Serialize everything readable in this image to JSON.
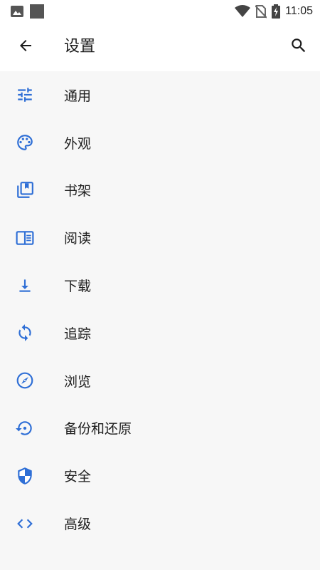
{
  "status_bar": {
    "time": "11:05",
    "icons": [
      "image-icon",
      "square-icon",
      "wifi-icon",
      "no-sim-icon",
      "battery-charging-icon"
    ]
  },
  "app_bar": {
    "title": "设置",
    "back_icon": "arrow-back-icon",
    "search_icon": "search-icon"
  },
  "settings": {
    "items": [
      {
        "label": "通用",
        "icon": "tune-icon"
      },
      {
        "label": "外观",
        "icon": "palette-icon"
      },
      {
        "label": "书架",
        "icon": "library-icon"
      },
      {
        "label": "阅读",
        "icon": "chrome-reader-icon"
      },
      {
        "label": "下载",
        "icon": "download-icon"
      },
      {
        "label": "追踪",
        "icon": "sync-icon"
      },
      {
        "label": "浏览",
        "icon": "compass-icon"
      },
      {
        "label": "备份和还原",
        "icon": "backup-restore-icon"
      },
      {
        "label": "安全",
        "icon": "shield-icon"
      },
      {
        "label": "高级",
        "icon": "code-icon"
      }
    ]
  },
  "colors": {
    "accent": "#2f6fd6",
    "background": "#f7f7f7",
    "bar": "#ffffff",
    "text": "#212121"
  }
}
